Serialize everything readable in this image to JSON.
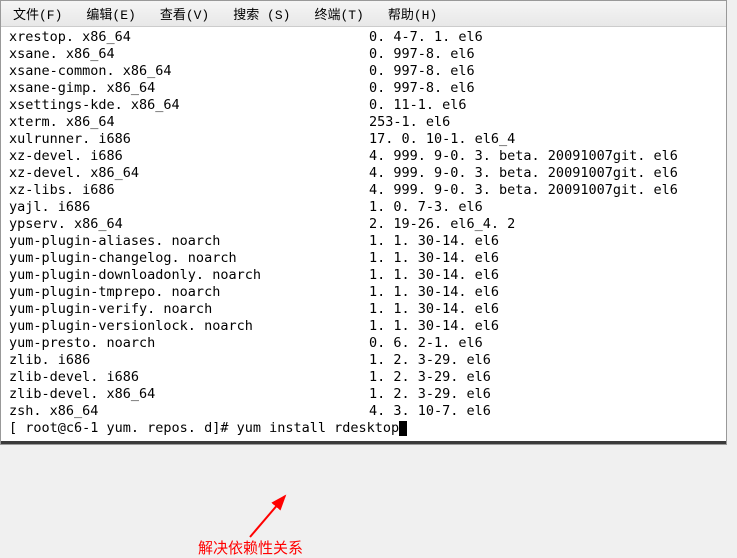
{
  "menubar": {
    "file": "文件(F)",
    "edit": "编辑(E)",
    "view": "查看(V)",
    "search": "搜索 (S)",
    "terminal": "终端(T)",
    "help": "帮助(H)"
  },
  "packages": [
    {
      "name": "xrestop. x86_64",
      "version": "0. 4-7. 1. el6"
    },
    {
      "name": "xsane. x86_64",
      "version": "0. 997-8. el6"
    },
    {
      "name": "xsane-common. x86_64",
      "version": "0. 997-8. el6"
    },
    {
      "name": "xsane-gimp. x86_64",
      "version": "0. 997-8. el6"
    },
    {
      "name": "xsettings-kde. x86_64",
      "version": "0. 11-1. el6"
    },
    {
      "name": "xterm. x86_64",
      "version": "253-1. el6"
    },
    {
      "name": "xulrunner. i686",
      "version": "17. 0. 10-1. el6_4"
    },
    {
      "name": "xz-devel. i686",
      "version": "4. 999. 9-0. 3. beta. 20091007git. el6"
    },
    {
      "name": "xz-devel. x86_64",
      "version": "4. 999. 9-0. 3. beta. 20091007git. el6"
    },
    {
      "name": "xz-libs. i686",
      "version": "4. 999. 9-0. 3. beta. 20091007git. el6"
    },
    {
      "name": "yajl. i686",
      "version": "1. 0. 7-3. el6"
    },
    {
      "name": "ypserv. x86_64",
      "version": "2. 19-26. el6_4. 2"
    },
    {
      "name": "yum-plugin-aliases. noarch",
      "version": "1. 1. 30-14. el6"
    },
    {
      "name": "yum-plugin-changelog. noarch",
      "version": "1. 1. 30-14. el6"
    },
    {
      "name": "yum-plugin-downloadonly. noarch",
      "version": "1. 1. 30-14. el6"
    },
    {
      "name": "yum-plugin-tmprepo. noarch",
      "version": "1. 1. 30-14. el6"
    },
    {
      "name": "yum-plugin-verify. noarch",
      "version": "1. 1. 30-14. el6"
    },
    {
      "name": "yum-plugin-versionlock. noarch",
      "version": "1. 1. 30-14. el6"
    },
    {
      "name": "yum-presto. noarch",
      "version": "0. 6. 2-1. el6"
    },
    {
      "name": "zlib. i686",
      "version": "1. 2. 3-29. el6"
    },
    {
      "name": "zlib-devel. i686",
      "version": "1. 2. 3-29. el6"
    },
    {
      "name": "zlib-devel. x86_64",
      "version": "1. 2. 3-29. el6"
    },
    {
      "name": "zsh. x86_64",
      "version": "4. 3. 10-7. el6"
    }
  ],
  "prompt": {
    "text": "[ root@c6-1 yum. repos. d]# ",
    "command": "yum install rdesktop"
  },
  "annotation": {
    "text": "解决依赖性关系",
    "arrow_color": "#ff0000"
  }
}
